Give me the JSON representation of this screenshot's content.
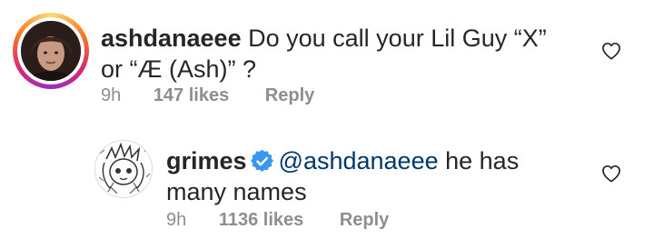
{
  "comments": [
    {
      "username": "ashdanaeee",
      "text": "Do you call your Lil Guy “X” or “Æ (Ash)” ?",
      "time": "9h",
      "likes": "147 likes",
      "reply_label": "Reply",
      "avatar_icon": "user-photo-avatar",
      "like_icon": "heart-outline-icon"
    },
    {
      "username": "grimes",
      "verified": true,
      "verified_icon": "verified-badge-icon",
      "mention": "@ashdanaeee",
      "text": "he has many names",
      "time": "9h",
      "likes": "1136 likes",
      "reply_label": "Reply",
      "avatar_icon": "drawn-character-avatar",
      "like_icon": "heart-outline-icon"
    }
  ],
  "colors": {
    "text": "#262626",
    "meta": "#8e8e8e",
    "mention": "#00376b",
    "verified": "#3897f0"
  }
}
